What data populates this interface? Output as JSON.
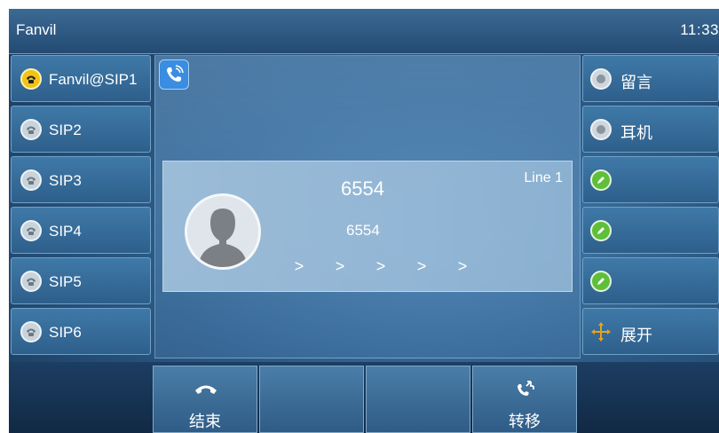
{
  "header": {
    "brand": "Fanvil",
    "time": "11:33"
  },
  "line_keys": [
    {
      "label": "Fanvil@SIP1",
      "state": "active"
    },
    {
      "label": "SIP2",
      "state": "idle"
    },
    {
      "label": "SIP3",
      "state": "idle"
    },
    {
      "label": "SIP4",
      "state": "idle"
    },
    {
      "label": "SIP5",
      "state": "idle"
    },
    {
      "label": "SIP6",
      "state": "idle"
    }
  ],
  "call": {
    "number": "6554",
    "name": "6554",
    "line": "Line 1",
    "progress_arrows": [
      ">",
      ">",
      ">",
      ">",
      ">"
    ]
  },
  "function_keys": [
    {
      "label": "留言",
      "icon": "voicemail-icon"
    },
    {
      "label": "耳机",
      "icon": "headset-icon"
    },
    {
      "label": "",
      "icon": "edit-icon"
    },
    {
      "label": "",
      "icon": "edit-icon"
    },
    {
      "label": "",
      "icon": "edit-icon"
    },
    {
      "label": "展开",
      "icon": "expand-icon"
    }
  ],
  "soft_keys": [
    {
      "label": "结束",
      "icon": "hangup-icon"
    },
    {
      "label": "",
      "icon": ""
    },
    {
      "label": "",
      "icon": ""
    },
    {
      "label": "转移",
      "icon": "transfer-icon"
    }
  ],
  "colors": {
    "active_line": "#f2c317",
    "edit_icon": "#5fbf3a",
    "call_icon": "#3a8de0"
  }
}
